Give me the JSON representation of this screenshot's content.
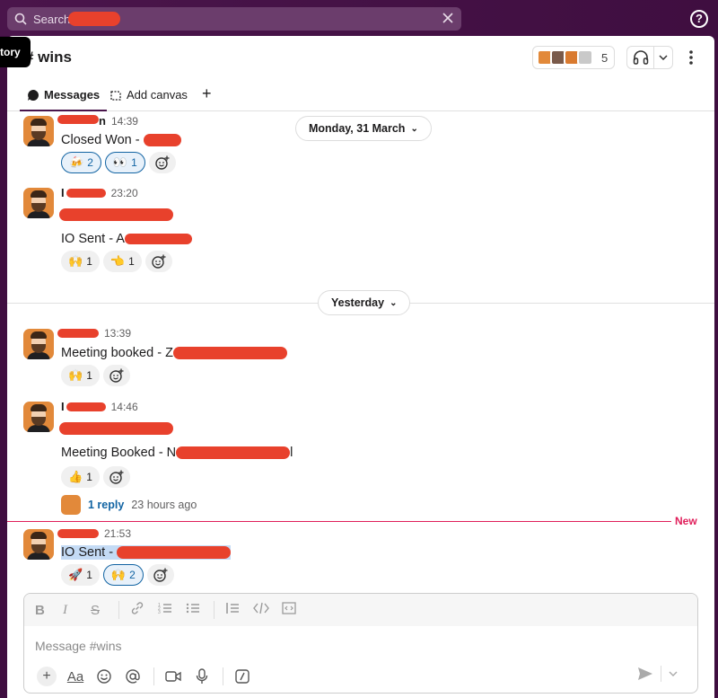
{
  "search": {
    "placeholder": "Search "
  },
  "help_icon": "?",
  "tooltip_text": "tory",
  "channel": {
    "title": "# wins",
    "member_count": "5"
  },
  "tabs": [
    {
      "label": "Messages",
      "icon": "message-bubble-icon"
    },
    {
      "label": "Add canvas",
      "icon": "canvas-icon"
    },
    {
      "label": "+",
      "icon": "plus-icon"
    }
  ],
  "day_dividers": {
    "first": "Monday, 31 March",
    "second": "Yesterday"
  },
  "messages": [
    {
      "time": "14:39",
      "name_suffix": "n",
      "text": "Closed Won - ",
      "reactions": [
        {
          "emoji": "🍻",
          "count": "2",
          "mine": true
        },
        {
          "emoji": "👀",
          "count": "1",
          "mine": true
        }
      ]
    },
    {
      "time": "23:20",
      "name_prefix": "I",
      "text": "IO Sent - A",
      "reactions": [
        {
          "emoji": "🙌",
          "count": "1",
          "mine": false
        },
        {
          "emoji": "👈",
          "count": "1",
          "mine": false
        }
      ]
    },
    {
      "time": "13:39",
      "text": "Meeting booked - Z",
      "reactions": [
        {
          "emoji": "🙌",
          "count": "1",
          "mine": false
        }
      ]
    },
    {
      "time": "14:46",
      "name_prefix": "I",
      "text": "Meeting Booked - N",
      "text_tail": "l",
      "reactions": [
        {
          "emoji": "👍",
          "count": "1",
          "mine": false
        }
      ],
      "thread": {
        "replies": "1 reply",
        "ago": "23 hours ago"
      }
    },
    {
      "time": "21:53",
      "text": "IO Sent - ",
      "reactions": [
        {
          "emoji": "🚀",
          "count": "1",
          "mine": false
        },
        {
          "emoji": "🙌",
          "count": "2",
          "mine": true
        }
      ]
    }
  ],
  "new_marker": "New",
  "composer": {
    "placeholder": "Message #wins",
    "format_buttons": [
      "B",
      "I",
      "S"
    ],
    "font_button": "Aa"
  }
}
